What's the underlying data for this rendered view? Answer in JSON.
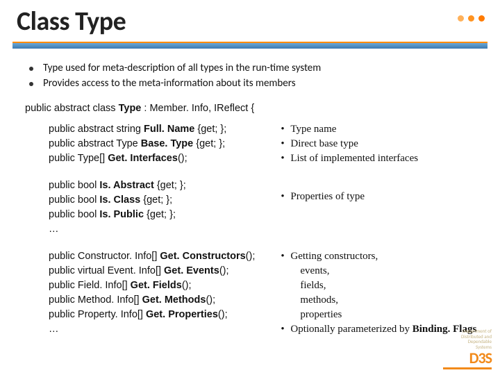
{
  "title": "Class Type",
  "intro": [
    "Type used for meta-description of all types in the run-time system",
    "Provides access to the meta-information about its members"
  ],
  "class_decl": {
    "prefix": "public abstract class ",
    "name": "Type",
    "suffix": " : Member. Info, IReflect {"
  },
  "sections": [
    {
      "code": [
        {
          "pre": "public abstract string ",
          "bold": "Full. Name",
          "post": " {get; };"
        },
        {
          "pre": "public abstract Type ",
          "bold": "Base. Type",
          "post": " {get; };"
        },
        {
          "pre": "public Type[] ",
          "bold": "Get. Interfaces",
          "post": "();"
        }
      ],
      "anno": [
        {
          "bullet": true,
          "text": "Type name"
        },
        {
          "bullet": true,
          "text": "Direct base type"
        },
        {
          "bullet": true,
          "text": "List of implemented interfaces"
        }
      ]
    },
    {
      "code": [
        {
          "pre": "public bool ",
          "bold": "Is. Abstract",
          "post": " {get; };"
        },
        {
          "pre": "public bool ",
          "bold": "Is. Class",
          "post": " {get; };"
        },
        {
          "pre": "public bool ",
          "bold": "Is. Public",
          "post": " {get; };"
        },
        {
          "pre": "…",
          "bold": "",
          "post": ""
        }
      ],
      "anno": [
        {
          "bullet": true,
          "text": "Properties of type"
        }
      ]
    },
    {
      "code": [
        {
          "pre": "public Constructor. Info[] ",
          "bold": "Get. Constructors",
          "post": "();"
        },
        {
          "pre": "public virtual Event. Info[] ",
          "bold": "Get. Events",
          "post": "();"
        },
        {
          "pre": "public Field. Info[] ",
          "bold": "Get. Fields",
          "post": "();"
        },
        {
          "pre": "public Method. Info[] ",
          "bold": "Get. Methods",
          "post": "();"
        },
        {
          "pre": "public Property. Info[] ",
          "bold": "Get. Properties",
          "post": "();"
        },
        {
          "pre": "…",
          "bold": "",
          "post": ""
        }
      ],
      "anno": [
        {
          "bullet": true,
          "text": "Getting constructors,"
        },
        {
          "bullet": false,
          "text": "events,"
        },
        {
          "bullet": false,
          "text": "fields,"
        },
        {
          "bullet": false,
          "text": "methods,"
        },
        {
          "bullet": false,
          "text": "properties"
        },
        {
          "bullet": true,
          "text": "Optionally parameterized by ",
          "bold_after": "Binding. Flags"
        }
      ]
    }
  ],
  "footer": {
    "dept1": "Department of",
    "dept2": "Distributed and",
    "dept3": "Dependable",
    "dept4": "Systems",
    "brand": "D3S"
  }
}
